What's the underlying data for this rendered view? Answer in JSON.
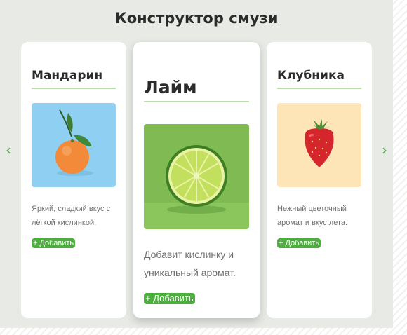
{
  "header": {
    "title": "Конструктор смузи"
  },
  "cards": [
    {
      "name": "Мандарин",
      "description": "Яркий, сладкий вкус с лёгкой кислинкой.",
      "add_label": "+ Добавить",
      "image_bg": "#8fd0f2",
      "fruit": "mandarin"
    },
    {
      "name": "Лайм",
      "description": "Добавит кислинку и уникальный аромат.",
      "add_label": "+ Добавить",
      "image_bg": "#7fbb52",
      "fruit": "lime"
    },
    {
      "name": "Клубника",
      "description": "Нежный цветочный аромат и вкус лета.",
      "add_label": "+ Добавить",
      "image_bg": "#fde5b7",
      "fruit": "strawberry"
    }
  ],
  "nav": {
    "prev_icon": "chevron-left-icon",
    "next_icon": "chevron-right-icon"
  },
  "colors": {
    "accent": "#4caf3d",
    "rule": "#b8dda6",
    "panel": "#e7eae5"
  }
}
